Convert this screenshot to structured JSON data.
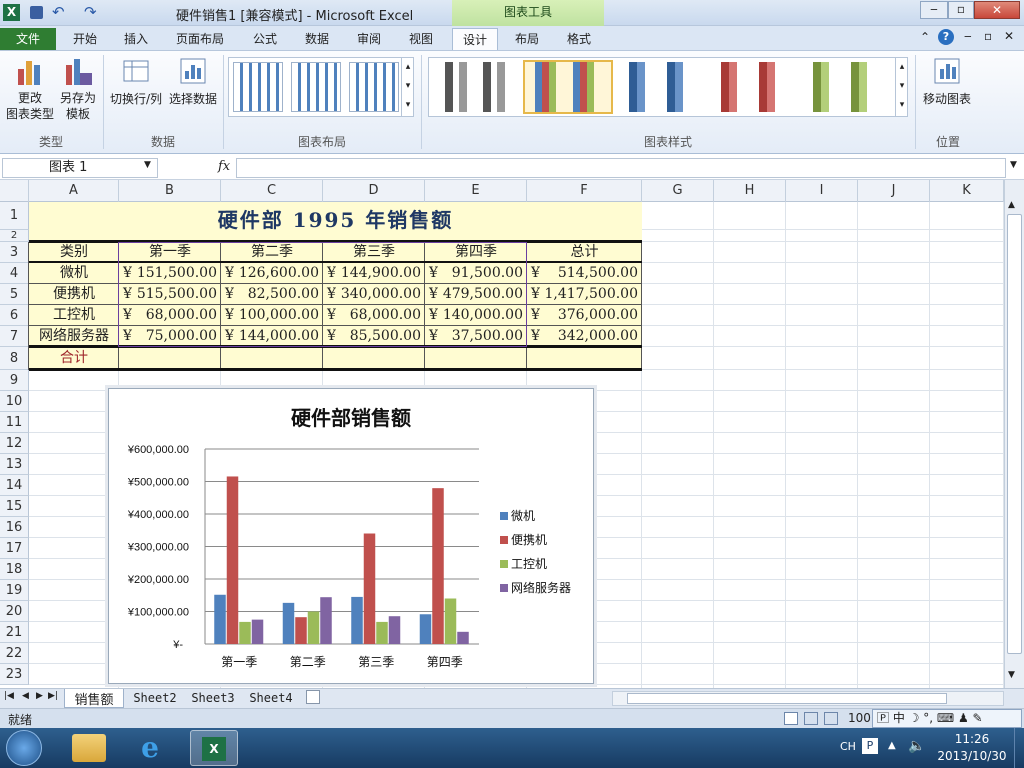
{
  "window": {
    "title": "硬件销售1 [兼容模式] - Microsoft Excel",
    "chart_tools": "图表工具"
  },
  "tabs": [
    "文件",
    "开始",
    "插入",
    "页面布局",
    "公式",
    "数据",
    "审阅",
    "视图",
    "设计",
    "布局",
    "格式"
  ],
  "ribbon": {
    "type": {
      "btn1": "更改\n图表类型",
      "btn2": "另存为\n模板",
      "label": "类型"
    },
    "data": {
      "btn1": "切换行/列",
      "btn2": "选择数据",
      "label": "数据"
    },
    "layout": {
      "label": "图表布局"
    },
    "styles": {
      "label": "图表样式"
    },
    "location": {
      "btn1": "移动图表",
      "label": "位置"
    }
  },
  "namebox": "图表 1",
  "fx": "fx",
  "columns": [
    "A",
    "B",
    "C",
    "D",
    "E",
    "F",
    "G",
    "H",
    "I",
    "J",
    "K"
  ],
  "rows": [
    "1",
    "2",
    "3",
    "4",
    "5",
    "6",
    "7",
    "8",
    "9",
    "10",
    "11",
    "12",
    "13",
    "14",
    "15",
    "16",
    "17",
    "18",
    "19",
    "20",
    "21",
    "22",
    "23"
  ],
  "sheet": {
    "title": "硬件部 1995 年销售额",
    "headers": [
      "类别",
      "第一季",
      "第二季",
      "第三季",
      "第四季",
      "总计"
    ],
    "currency": "¥",
    "data": [
      [
        "微机",
        "151,500.00",
        "126,600.00",
        "144,900.00",
        "91,500.00",
        "514,500.00"
      ],
      [
        "便携机",
        "515,500.00",
        "82,500.00",
        "340,000.00",
        "479,500.00",
        "1,417,500.00"
      ],
      [
        "工控机",
        "68,000.00",
        "100,000.00",
        "68,000.00",
        "140,000.00",
        "376,000.00"
      ],
      [
        "网络服务器",
        "75,000.00",
        "144,000.00",
        "85,500.00",
        "37,500.00",
        "342,000.00"
      ]
    ],
    "total_label": "合计"
  },
  "chart_data": {
    "type": "bar",
    "title": "硬件部销售额",
    "categories": [
      "第一季",
      "第二季",
      "第三季",
      "第四季"
    ],
    "series": [
      {
        "name": "微机",
        "values": [
          151500,
          126600,
          144900,
          91500
        ],
        "color": "#4f81bd"
      },
      {
        "name": "便携机",
        "values": [
          515500,
          82500,
          340000,
          479500
        ],
        "color": "#c0504d"
      },
      {
        "name": "工控机",
        "values": [
          68000,
          100000,
          68000,
          140000
        ],
        "color": "#9bbb59"
      },
      {
        "name": "网络服务器",
        "values": [
          75000,
          144000,
          85500,
          37500
        ],
        "color": "#8064a2"
      }
    ],
    "ylim": [
      0,
      600000
    ],
    "yticks": [
      "¥-",
      "¥100,000.00",
      "¥200,000.00",
      "¥300,000.00",
      "¥400,000.00",
      "¥500,000.00",
      "¥600,000.00"
    ],
    "legend": "right"
  },
  "sheet_tabs": [
    "销售额",
    "Sheet2",
    "Sheet3",
    "Sheet4"
  ],
  "status": {
    "ready": "就绪",
    "zoom": "100"
  },
  "taskbar": {
    "lang": "CH",
    "time": "11:26",
    "date": "2013/10/30"
  }
}
